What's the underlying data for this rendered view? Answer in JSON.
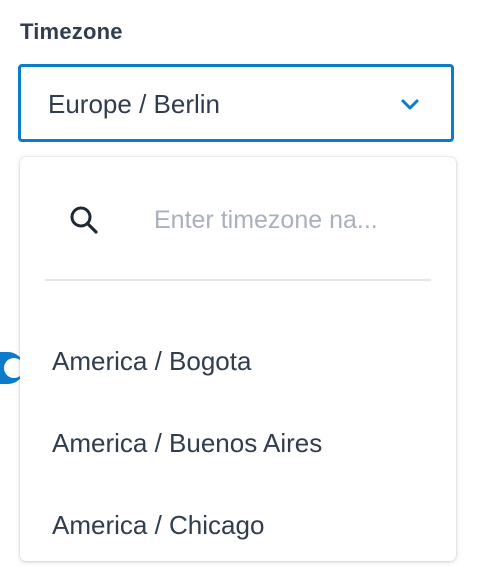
{
  "field": {
    "label": "Timezone",
    "selected_value": "Europe / Berlin",
    "chevron_icon": "chevron-down-icon",
    "accent_color": "#0c7bc9"
  },
  "dropdown": {
    "search": {
      "icon": "search-icon",
      "placeholder": "Enter timezone na...",
      "value": ""
    },
    "options": [
      {
        "label": "America / Bogota"
      },
      {
        "label": "America / Buenos Aires"
      },
      {
        "label": "America / Chicago"
      }
    ]
  }
}
